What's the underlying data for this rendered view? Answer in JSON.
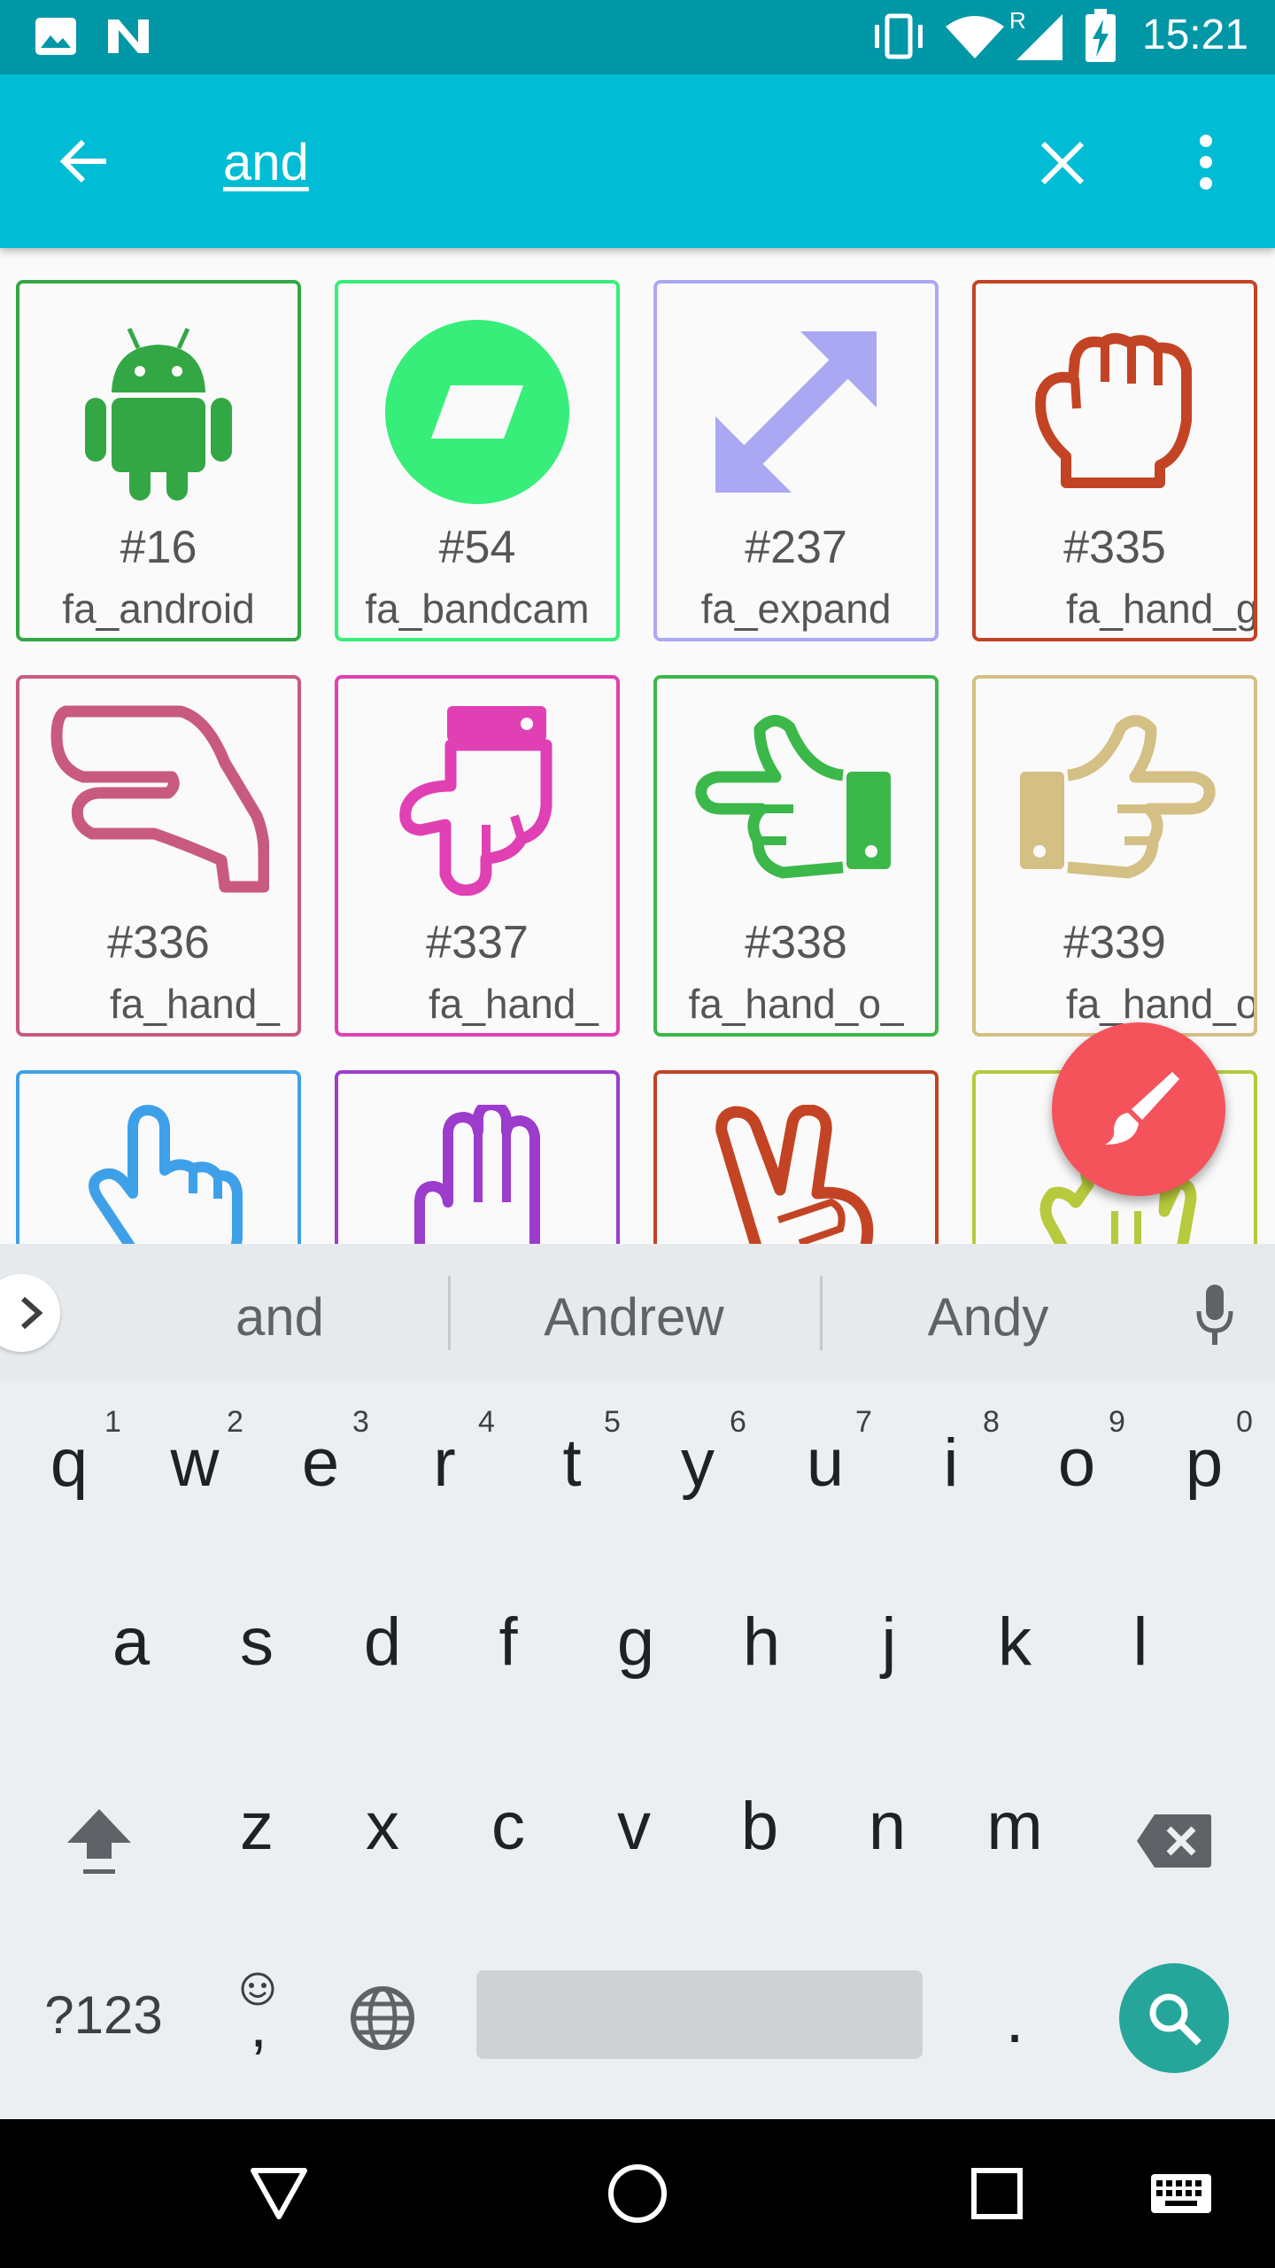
{
  "status_bar": {
    "time": "15:21",
    "roaming_indicator": "R"
  },
  "toolbar": {
    "search_query": "and"
  },
  "icons": [
    {
      "number": "#16",
      "name": "fa_android",
      "color": "#34a745",
      "icon": "android-icon"
    },
    {
      "number": "#54",
      "name": "fa_bandcam",
      "color": "#38ee7a",
      "icon": "bandcamp-icon"
    },
    {
      "number": "#237",
      "name": "fa_expand",
      "color": "#aaa8f2",
      "icon": "expand-icon"
    },
    {
      "number": "#335",
      "name": "fa_hand_g",
      "color": "#c34424",
      "icon": "hand-grab-icon"
    },
    {
      "number": "#336",
      "name": "fa_hand_",
      "color": "#c85a80",
      "icon": "hand-lizard-icon"
    },
    {
      "number": "#337",
      "name": "fa_hand_",
      "color": "#e040b4",
      "icon": "hand-point-down-icon"
    },
    {
      "number": "#338",
      "name": "fa_hand_o_",
      "color": "#3cb84a",
      "icon": "hand-point-left-icon"
    },
    {
      "number": "#339",
      "name": "fa_hand_o",
      "color": "#d4bf84",
      "icon": "hand-point-right-icon"
    },
    {
      "number": "",
      "name": "",
      "color": "#3ea0e8",
      "icon": "hand-pointer-icon"
    },
    {
      "number": "",
      "name": "",
      "color": "#9c3ccc",
      "icon": "hand-paper-icon"
    },
    {
      "number": "",
      "name": "",
      "color": "#c34424",
      "icon": "hand-peace-icon"
    },
    {
      "number": "",
      "name": "",
      "color": "#b7c93c",
      "icon": "hand-spock-icon"
    }
  ],
  "suggestions": [
    "and",
    "Andrew",
    "Andy"
  ],
  "keyboard": {
    "row1": [
      "q",
      "w",
      "e",
      "r",
      "t",
      "y",
      "u",
      "i",
      "o",
      "p"
    ],
    "row1_hints": [
      "1",
      "2",
      "3",
      "4",
      "5",
      "6",
      "7",
      "8",
      "9",
      "0"
    ],
    "row2": [
      "a",
      "s",
      "d",
      "f",
      "g",
      "h",
      "j",
      "k",
      "l"
    ],
    "row3": [
      "z",
      "x",
      "c",
      "v",
      "b",
      "n",
      "m"
    ],
    "symbols_key": "?123",
    "comma_key": ",",
    "period_key": "."
  },
  "colors": {
    "status_bar": "#0097a7",
    "toolbar": "#00bcd4",
    "fab": "#f5535b",
    "search_key": "#26a69a"
  }
}
